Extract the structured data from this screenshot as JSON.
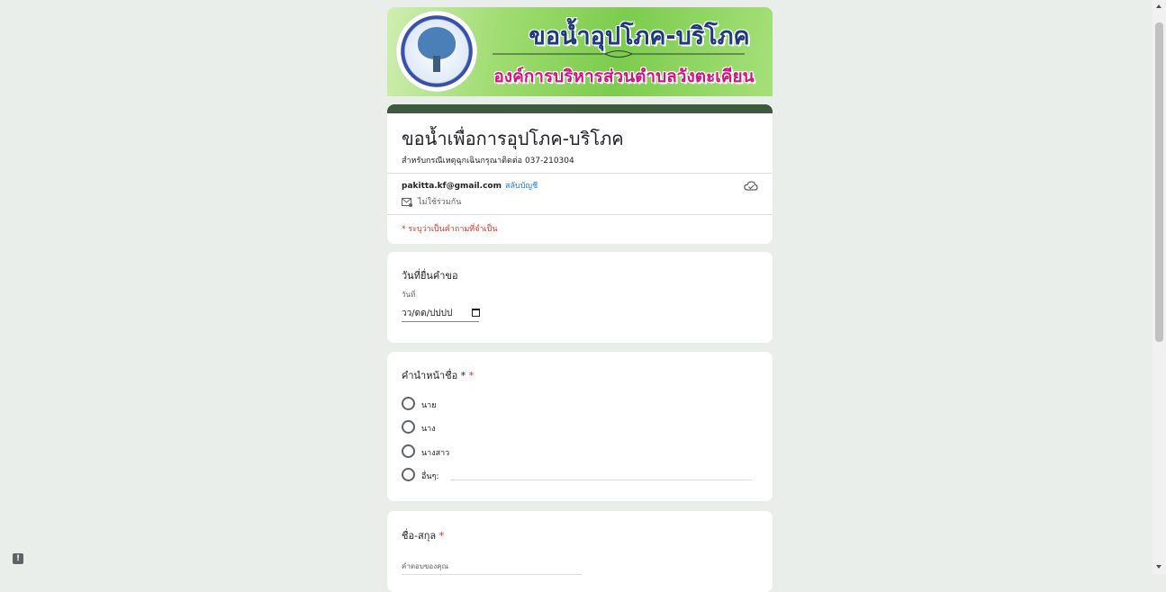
{
  "banner": {
    "title": "ขอน้ำอุปโภค-บริโภค",
    "subtitle": "องค์การบริหารส่วนตำบลวังตะเคียน"
  },
  "header": {
    "title": "ขอน้ำเพื่อการอุปโภค-บริโภค",
    "description": "สำหรับกรณีเหตุฉุกเฉินกรุณาติดต่อ 037-210304"
  },
  "account": {
    "email": "pakitta.kf@gmail.com",
    "switch_label": "สลับบัญชี",
    "not_shared": "ไม่ใช้ร่วมกัน"
  },
  "required_note": "* ระบุว่าเป็นคำถามที่จำเป็น",
  "questions": {
    "date": {
      "label": "วันที่ยื่นคำขอ",
      "sub_label": "วันที่",
      "placeholder": "วว/ดด/ปปปป"
    },
    "title": {
      "label": "คำนำหน้าชื่อ *",
      "required_mark": "*",
      "options": [
        "นาย",
        "นาง",
        "นางสาว",
        "อื่นๆ:"
      ]
    },
    "name": {
      "label": "ชื่อ-สกุล",
      "required_mark": "*",
      "answer_placeholder": "คำตอบของคุณ"
    }
  },
  "feedback_icon": "!",
  "colors": {
    "page_bg": "#e9eeea",
    "header_bar": "#3d5a3d",
    "link": "#1a73e8",
    "required": "#d93025"
  },
  "icons": [
    "mail-icon",
    "cloud-icon",
    "calendar-icon",
    "report-feedback-icon",
    "radio-icon"
  ]
}
